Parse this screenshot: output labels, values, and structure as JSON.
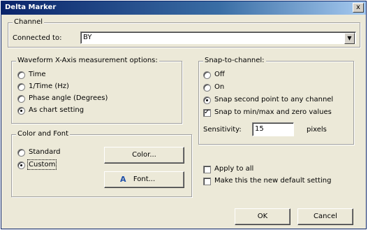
{
  "window": {
    "title": "Delta Marker",
    "close_label": "x"
  },
  "channel": {
    "group_label": "Channel",
    "connected_label": "Connected to:",
    "connected_value": "BY"
  },
  "waveform": {
    "group_label": "Waveform X-Axis measurement options:",
    "options": [
      {
        "label": "Time",
        "selected": false
      },
      {
        "label": "1/Time (Hz)",
        "selected": false
      },
      {
        "label": "Phase angle (Degrees)",
        "selected": false
      },
      {
        "label": "As chart setting",
        "selected": true
      }
    ]
  },
  "snap": {
    "group_label": "Snap-to-channel:",
    "radios": [
      {
        "label": "Off",
        "selected": false
      },
      {
        "label": "On",
        "selected": false
      },
      {
        "label": "Snap second point to any channel",
        "selected": true
      }
    ],
    "minmax_label": "Snap to min/max and zero values",
    "minmax_checked": true,
    "sensitivity_label": "Sensitivity:",
    "sensitivity_value": "15",
    "units_label": "pixels"
  },
  "colorfont": {
    "group_label": "Color and Font",
    "options": [
      {
        "label": "Standard",
        "selected": false
      },
      {
        "label": "Custom",
        "selected": true
      }
    ],
    "color_button": "Color...",
    "font_button": "Font...",
    "font_glyph": "A"
  },
  "apply": {
    "apply_all_label": "Apply to all",
    "default_label": "Make this the new default setting"
  },
  "footer": {
    "ok_label": "OK",
    "cancel_label": "Cancel"
  }
}
